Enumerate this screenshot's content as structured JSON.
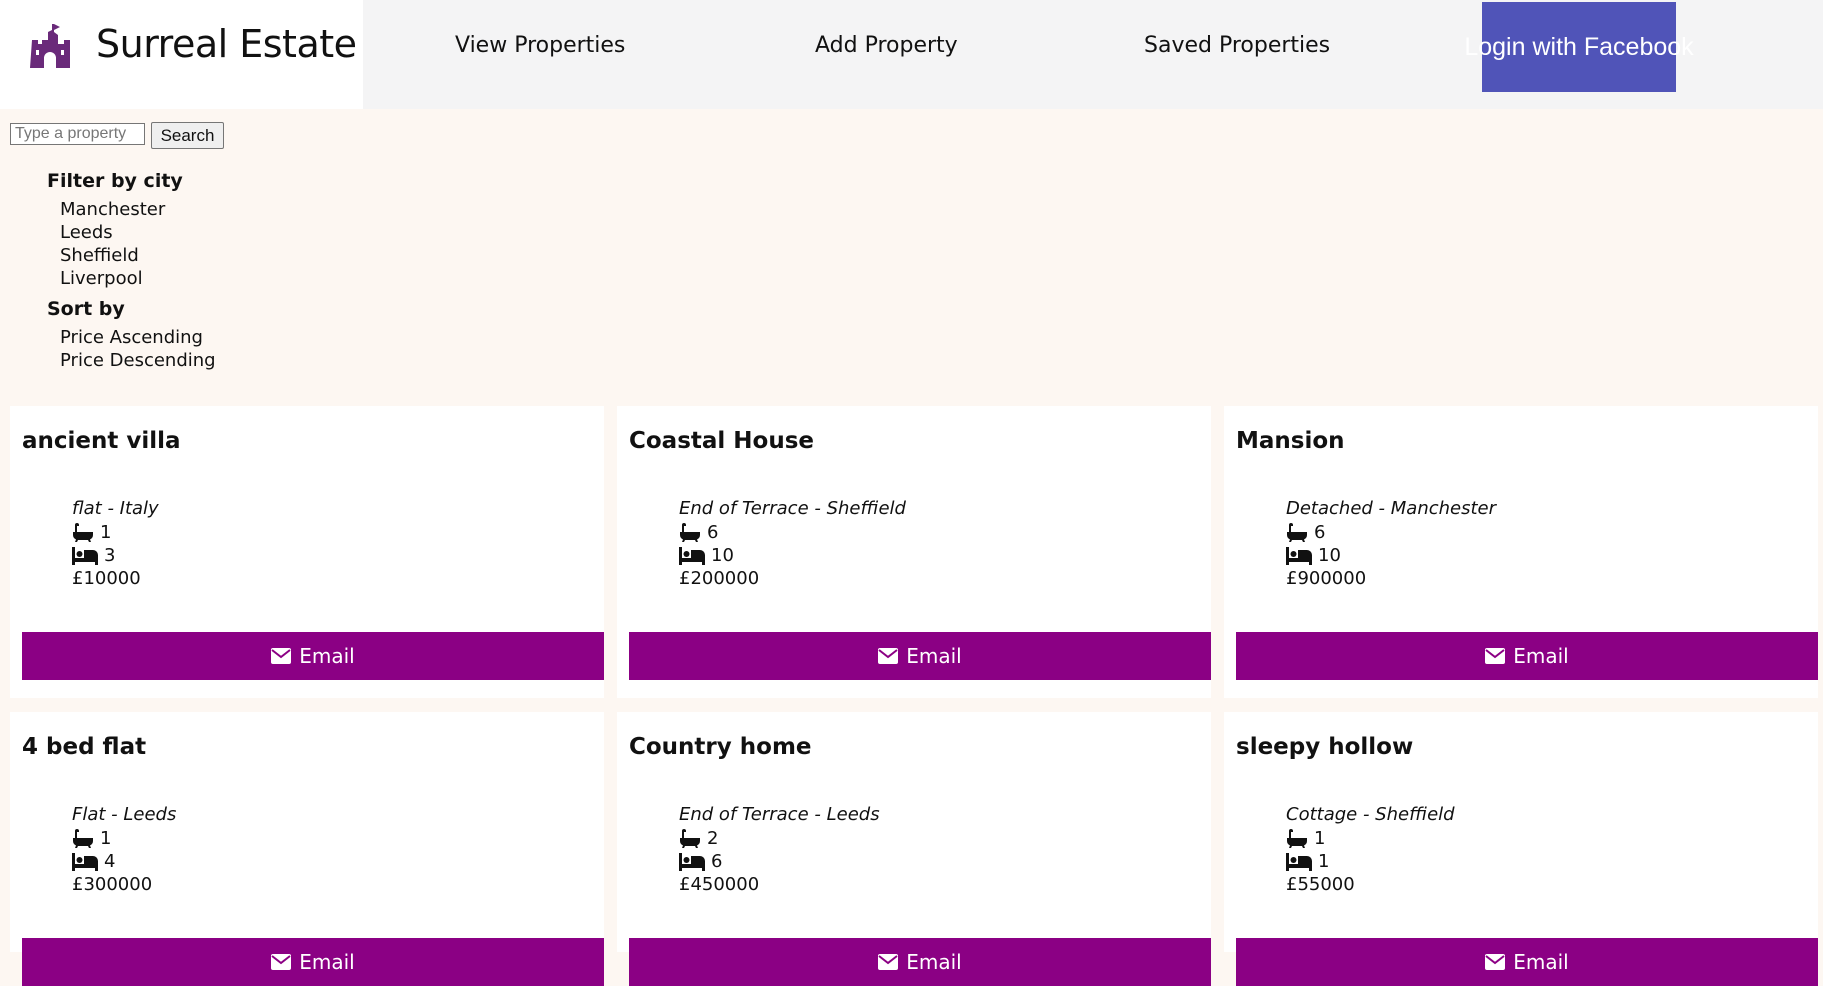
{
  "brand": {
    "name": "Surreal Estate",
    "logo_icon": "castle-icon",
    "logo_color": "#6a2a7a"
  },
  "nav": {
    "view_properties": "View Properties",
    "add_property": "Add Property",
    "saved_properties": "Saved Properties",
    "login": "Login with Facebook"
  },
  "search": {
    "placeholder": "Type a property",
    "value": "",
    "button": "Search"
  },
  "filters": {
    "city_heading": "Filter by city",
    "cities": [
      "Manchester",
      "Leeds",
      "Sheffield",
      "Liverpool"
    ],
    "sort_heading": "Sort by",
    "sort_options": [
      "Price Ascending",
      "Price Descending"
    ]
  },
  "colors": {
    "accent": "#8b0084",
    "facebook": "#5054b8",
    "page_bg": "#fdf7f2",
    "header_bg": "#f4f4f5"
  },
  "properties": [
    {
      "title": "ancient villa",
      "subtitle": "flat - Italy",
      "bathrooms": "1",
      "bedrooms": "3",
      "price": "£10000",
      "email": "Email"
    },
    {
      "title": "Coastal House",
      "subtitle": "End of Terrace - Sheffield",
      "bathrooms": "6",
      "bedrooms": "10",
      "price": "£200000",
      "email": "Email"
    },
    {
      "title": "Mansion",
      "subtitle": "Detached - Manchester",
      "bathrooms": "6",
      "bedrooms": "10",
      "price": "£900000",
      "email": "Email"
    },
    {
      "title": "4 bed flat",
      "subtitle": "Flat - Leeds",
      "bathrooms": "1",
      "bedrooms": "4",
      "price": "£300000",
      "email": "Email"
    },
    {
      "title": "Country home",
      "subtitle": "End of Terrace - Leeds",
      "bathrooms": "2",
      "bedrooms": "6",
      "price": "£450000",
      "email": "Email"
    },
    {
      "title": "sleepy hollow",
      "subtitle": "Cottage - Sheffield",
      "bathrooms": "1",
      "bedrooms": "1",
      "price": "£55000",
      "email": "Email"
    }
  ]
}
